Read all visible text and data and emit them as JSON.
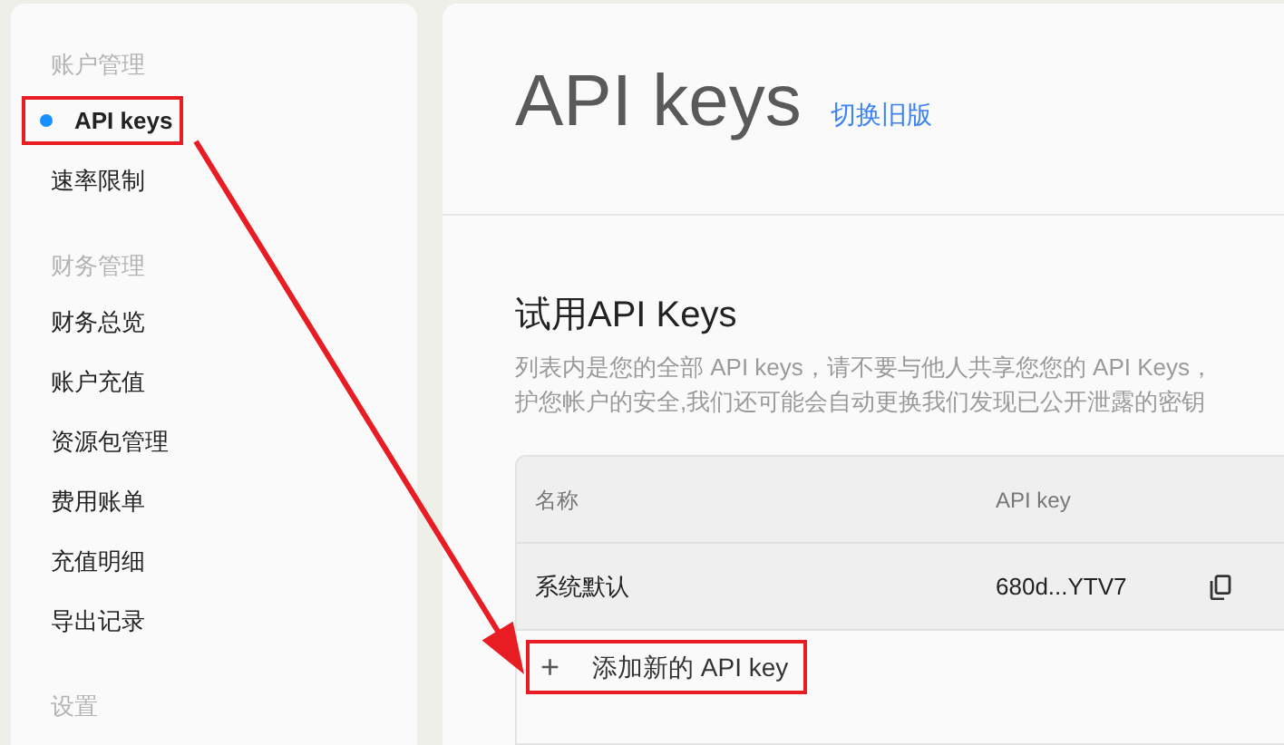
{
  "sidebar": {
    "groups": [
      {
        "heading": "账户管理",
        "items": [
          {
            "label": "API keys",
            "selected": true,
            "highlighted": true
          },
          {
            "label": "速率限制",
            "selected": false,
            "highlighted": false
          }
        ]
      },
      {
        "heading": "财务管理",
        "items": [
          {
            "label": "财务总览",
            "selected": false,
            "highlighted": false
          },
          {
            "label": "账户充值",
            "selected": false,
            "highlighted": false
          },
          {
            "label": "资源包管理",
            "selected": false,
            "highlighted": false
          },
          {
            "label": "费用账单",
            "selected": false,
            "highlighted": false
          },
          {
            "label": "充值明细",
            "selected": false,
            "highlighted": false
          },
          {
            "label": "导出记录",
            "selected": false,
            "highlighted": false
          }
        ]
      },
      {
        "heading": "设置"
      }
    ]
  },
  "page": {
    "title": "API keys",
    "switch_link": "切换旧版"
  },
  "section": {
    "title": "试用API Keys",
    "description_lines": [
      "列表内是您的全部 API keys，请不要与他人共享您您的 API Keys，",
      "护您帐户的安全,我们还可能会自动更换我们发现已公开泄露的密钥"
    ]
  },
  "table": {
    "columns": [
      "名称",
      "API key"
    ],
    "rows": [
      {
        "name": "系统默认",
        "key": "680d...YTV7"
      }
    ]
  },
  "add_button": {
    "icon": "+",
    "label": "添加新的 API key",
    "highlighted": true
  }
}
